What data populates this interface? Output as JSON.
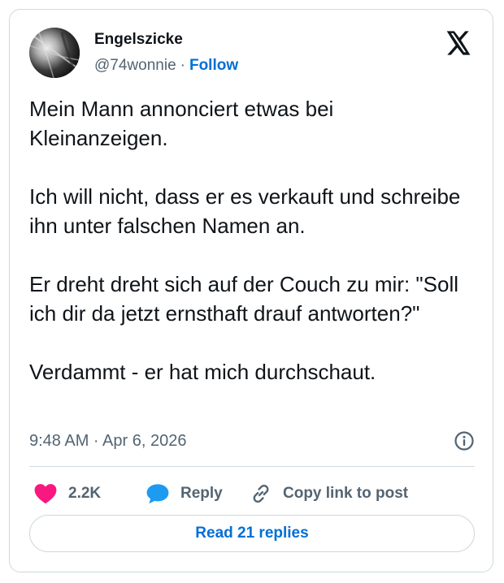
{
  "author": {
    "display_name": "Engelszicke",
    "handle": "@74wonnie",
    "separator": "·",
    "follow_label": "Follow",
    "avatar": "grayscale-hair-photo"
  },
  "brand": {
    "logo_icon": "x-logo-icon"
  },
  "tweet": {
    "paragraphs": [
      "Mein Mann annonciert etwas bei Kleinanzeigen.",
      "Ich will nicht, dass er es verkauft und schreibe ihn unter falschen Namen an.",
      "Er dreht dreht sich auf der Couch zu mir: \"Soll ich dir da jetzt ernsthaft drauf antworten?\"",
      "Verdammt - er hat mich durchschaut."
    ]
  },
  "meta": {
    "timestamp": "9:48 AM · Apr 6, 2026",
    "info_icon": "info-icon"
  },
  "actions": {
    "like_count": "2.2K",
    "reply_label": "Reply",
    "copy_link_label": "Copy link to post"
  },
  "footer": {
    "read_replies_label": "Read 21 replies"
  },
  "colors": {
    "accent": "#006fd6",
    "like": "#f91880",
    "reply_bubble": "#1d9bf0",
    "secondary_text": "#536471",
    "border": "#cfd9de"
  }
}
